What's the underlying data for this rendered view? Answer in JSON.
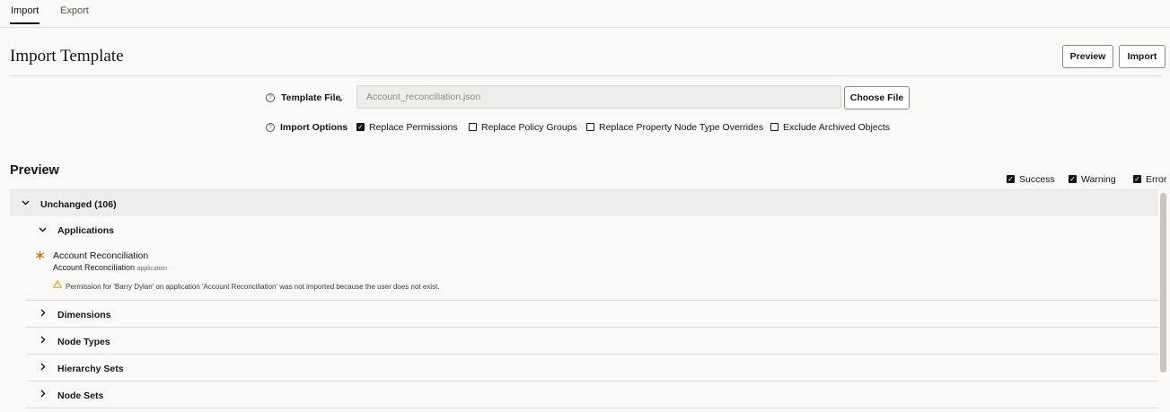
{
  "tabs": [
    {
      "label": "Import",
      "active": true
    },
    {
      "label": "Export",
      "active": false
    }
  ],
  "header": {
    "title": "Import Template",
    "preview_button": "Preview",
    "import_button": "Import"
  },
  "form": {
    "template_file_label": "Template File",
    "template_file_value": "Account_reconciliation.json",
    "choose_file_button": "Choose File",
    "import_options_label": "Import Options",
    "options": [
      {
        "label": "Replace Permissions",
        "checked": true
      },
      {
        "label": "Replace Policy Groups",
        "checked": false
      },
      {
        "label": "Replace Property Node Type Overrides",
        "checked": false
      },
      {
        "label": "Exclude Archived Objects",
        "checked": false
      }
    ]
  },
  "preview": {
    "title": "Preview",
    "filters": [
      {
        "label": "Success",
        "checked": true
      },
      {
        "label": "Warning",
        "checked": true
      },
      {
        "label": "Error",
        "checked": true
      }
    ],
    "group": {
      "label": "Unchanged (106)",
      "expanded": true
    },
    "applications": {
      "label": "Applications",
      "item_name": "Account Reconciliation",
      "item_subtitle": "Account Reconciliation",
      "item_type": "application",
      "warning": "Permission for 'Barry Dylan' on application 'Account Reconciliation' was not imported because the user does not exist."
    },
    "collapsed_sections": [
      "Dimensions",
      "Node Types",
      "Hierarchy Sets",
      "Node Sets"
    ]
  },
  "colors": {
    "background": "#fbf9f8",
    "text": "#161513",
    "required_dot": "#227e9e",
    "app_icon": "#c77a25",
    "warning_icon": "#d9a41d"
  },
  "icons": {
    "help": "question-circle-icon",
    "chevron_down": "chevron-down-icon",
    "chevron_right": "chevron-right-icon",
    "app": "application-snowflake-icon",
    "warning": "warning-triangle-icon",
    "check": "check-icon"
  }
}
